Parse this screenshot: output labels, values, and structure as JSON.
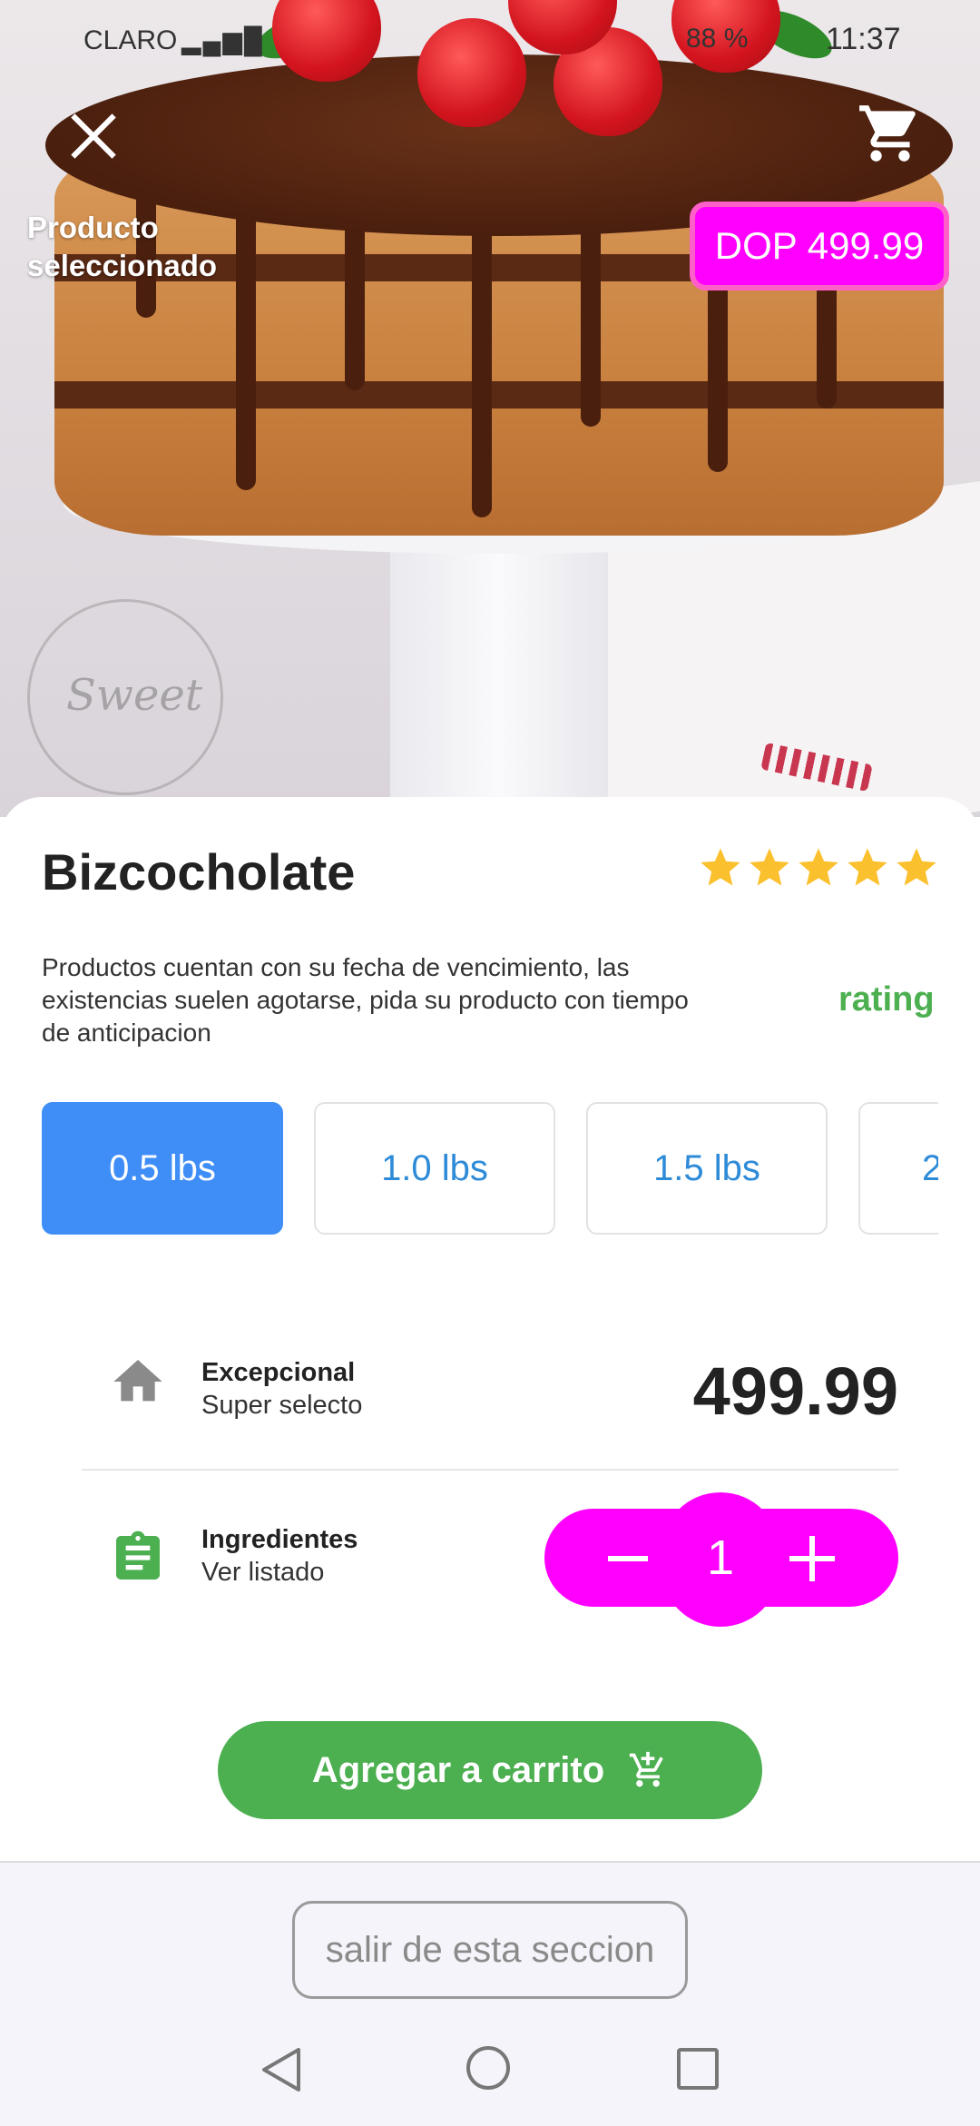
{
  "status_bar": {
    "carrier": "CLARO",
    "battery": "88 %",
    "time": "11:37"
  },
  "header": {
    "selected_label": "Producto seleccionado",
    "price_badge": "DOP 499.99",
    "close_icon": "close-icon",
    "cart_icon": "cart-icon"
  },
  "hero": {
    "watermark": "Sweet"
  },
  "product": {
    "title": "Bizcocholate",
    "stars": 5,
    "description": "Productos cuentan con su fecha de vencimiento, las existencias suelen agotarse, pida su producto con tiempo de anticipacion",
    "rating_label": "rating"
  },
  "sizes": [
    {
      "label": "0.5 lbs",
      "selected": true
    },
    {
      "label": "1.0 lbs",
      "selected": false
    },
    {
      "label": "1.5 lbs",
      "selected": false
    },
    {
      "label": "2",
      "selected": false
    }
  ],
  "info": {
    "quality_title": "Excepcional",
    "quality_sub": "Super selecto",
    "price": "499.99",
    "ingredients_title": "Ingredientes",
    "ingredients_sub": "Ver listado"
  },
  "stepper": {
    "quantity": "1"
  },
  "actions": {
    "add_to_cart": "Agregar a carrito",
    "exit": "salir de esta seccion"
  },
  "colors": {
    "accent_magenta": "#ff00ff",
    "green": "#4caf50",
    "blue_selected": "#3f8ef7",
    "star": "#fbc02d"
  }
}
